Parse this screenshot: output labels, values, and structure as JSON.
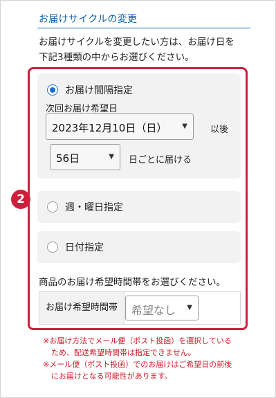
{
  "section": {
    "title": "お届けサイクルの変更",
    "intro_line1": "お届けサイクルを変更したい方は、お届け日を",
    "intro_line2": "下記3種類の中からお選びください。"
  },
  "step_badge": "2",
  "options": {
    "interval": {
      "label": "お届け間隔指定",
      "selected": true,
      "next_date_label": "次回お届け希望日",
      "next_date_value": "2023年12月10日（日）",
      "after_label": "以後",
      "interval_value": "56日",
      "interval_suffix": "日ごとに届ける"
    },
    "weekday": {
      "label": "週・曜日指定",
      "selected": false
    },
    "date": {
      "label": "日付指定",
      "selected": false
    }
  },
  "time": {
    "prompt": "商品のお届け希望時間帯をお選びください。",
    "header": "お届け希望時間帯",
    "select_value": "希望なし"
  },
  "notes": {
    "line1": "※お届け方法でメール便（ポスト投函）を選択している",
    "line2": "ため、配送希望時間帯は指定できません。",
    "line3": "※メール便（ポスト投函）でのお届けはご希望日の前後",
    "line4": "にお届けとなる可能性があります。"
  },
  "colors": {
    "accent_blue": "#0b5ea8",
    "highlight_red": "#cc1f3c",
    "radio_blue": "#1c6ed6",
    "note_red": "#d11a2a"
  },
  "icons": [
    "chevron-down-icon",
    "radio-checked-icon",
    "radio-unchecked-icon"
  ]
}
